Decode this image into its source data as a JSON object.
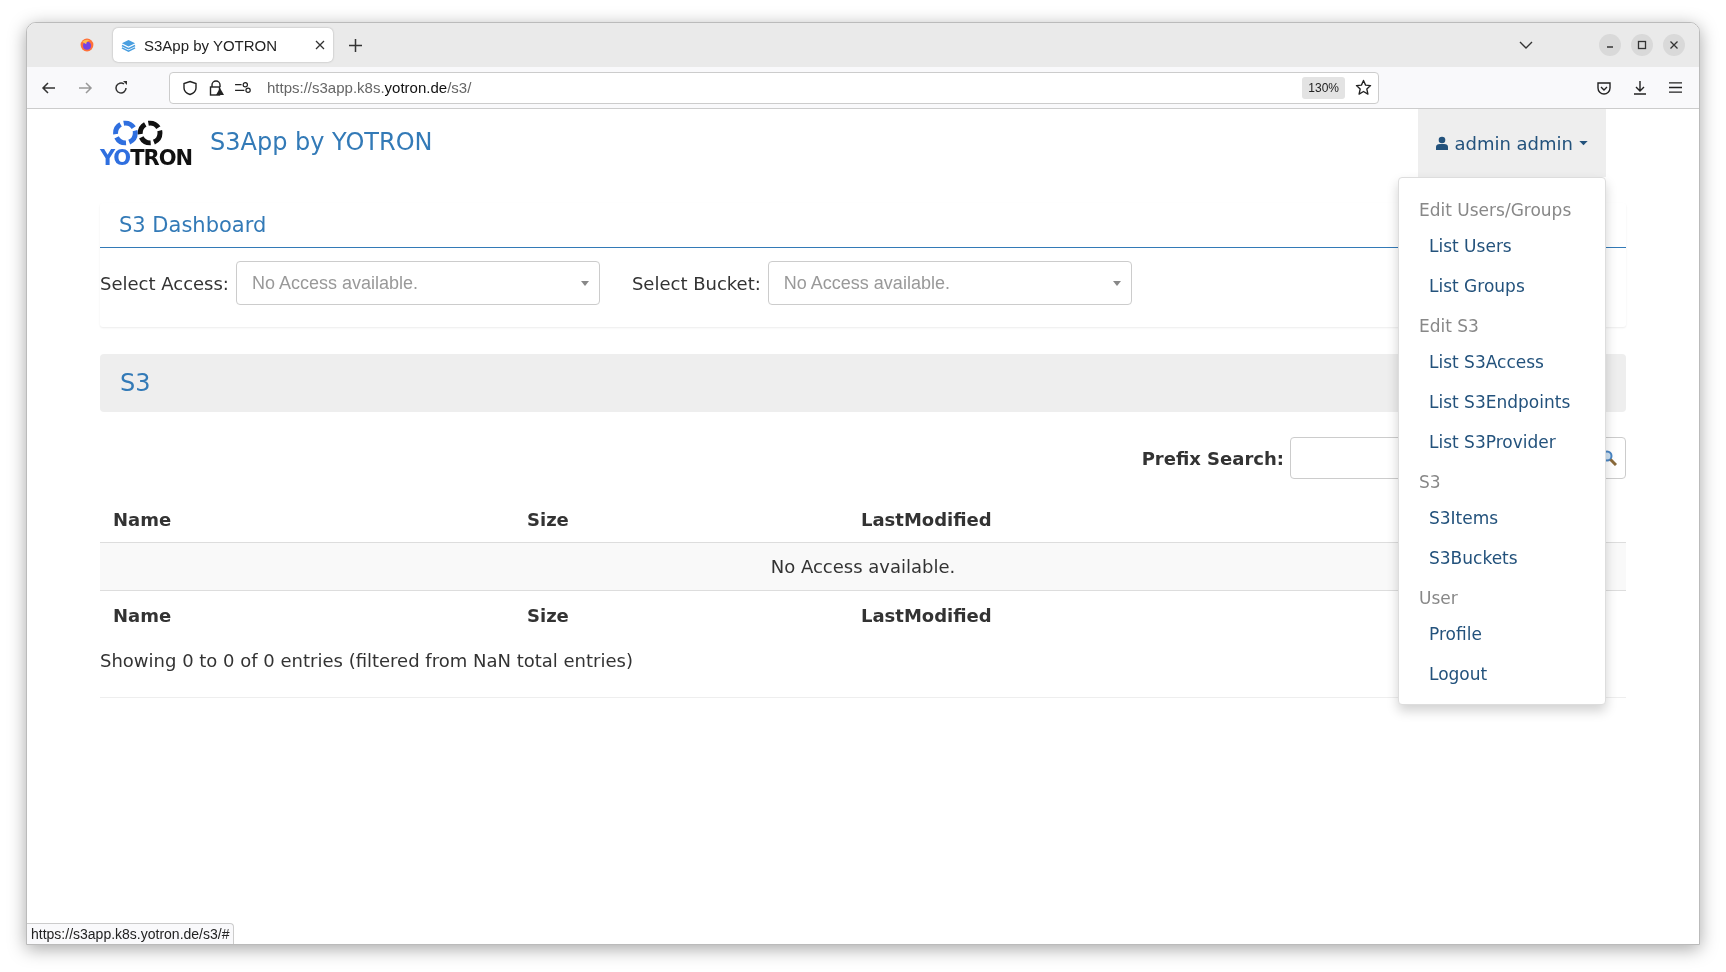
{
  "browser": {
    "tab": {
      "title": "S3App by YOTRON",
      "selected": true
    },
    "url": {
      "prefix": "https://s3app.k8s.",
      "domain": "yotron.de",
      "path": "/s3/"
    },
    "zoom": "130%"
  },
  "header": {
    "logo": [
      {
        "text": "YO",
        "color": "#2f6fdf"
      },
      {
        "text": "TRON",
        "color": "#111111"
      }
    ],
    "brand": "S3App by YOTRON",
    "user_menu": {
      "label": "admin admin",
      "expanded": true
    }
  },
  "menu": [
    {
      "kind": "header",
      "label": "Edit Users/Groups"
    },
    {
      "kind": "item",
      "label": "List Users"
    },
    {
      "kind": "item",
      "label": "List Groups"
    },
    {
      "kind": "header",
      "label": "Edit S3"
    },
    {
      "kind": "item",
      "label": "List S3Access"
    },
    {
      "kind": "item",
      "label": "List S3Endpoints"
    },
    {
      "kind": "item",
      "label": "List S3Provider"
    },
    {
      "kind": "header",
      "label": "S3"
    },
    {
      "kind": "item",
      "label": "S3Items"
    },
    {
      "kind": "item",
      "label": "S3Buckets"
    },
    {
      "kind": "header",
      "label": "User"
    },
    {
      "kind": "item",
      "label": "Profile"
    },
    {
      "kind": "item",
      "label": "Logout"
    }
  ],
  "dashboard": {
    "title": "S3 Dashboard",
    "filters": [
      {
        "label": "Select Access:",
        "placeholder": "No Access available."
      },
      {
        "label": "Select Bucket:",
        "placeholder": "No Access available."
      }
    ]
  },
  "section": {
    "title": "S3"
  },
  "search": {
    "label": "Prefix Search:"
  },
  "table": {
    "columns": [
      "Name",
      "Size",
      "LastModified"
    ],
    "footer_columns": [
      "Name",
      "Size",
      "LastModified"
    ],
    "empty_message": "No Access available.",
    "info": "Showing 0 to 0 of 0 entries (filtered from NaN total entries)"
  },
  "status_bar": "https://s3app.k8s.yotron.de/s3/#"
}
